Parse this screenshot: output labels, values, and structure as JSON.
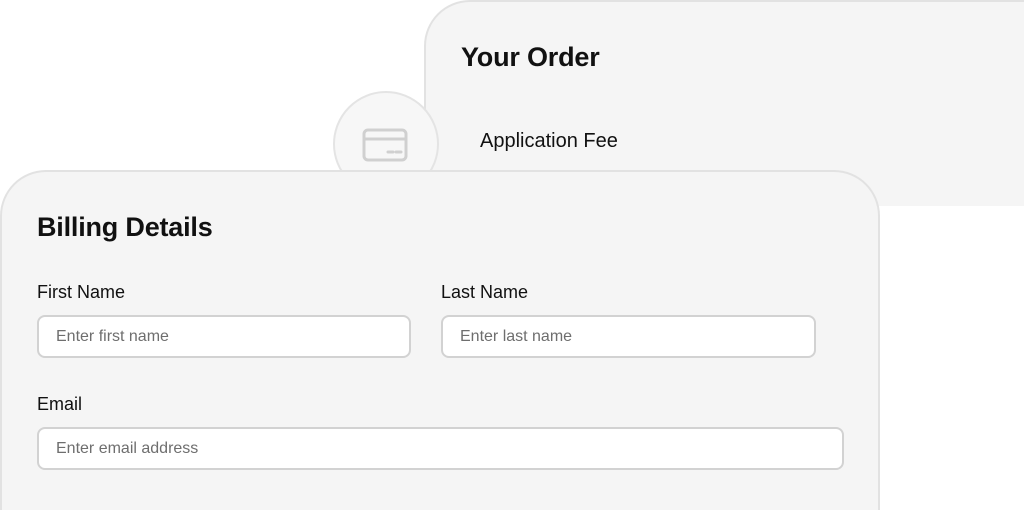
{
  "order": {
    "title": "Your Order",
    "items": [
      {
        "label": "Application Fee"
      }
    ]
  },
  "billing": {
    "title": "Billing Details",
    "first_name": {
      "label": "First Name",
      "placeholder": "Enter first name",
      "value": ""
    },
    "last_name": {
      "label": "Last Name",
      "placeholder": "Enter last name",
      "value": ""
    },
    "email": {
      "label": "Email",
      "placeholder": "Enter email address",
      "value": ""
    }
  },
  "icons": {
    "payment_badge": "credit-card-icon"
  },
  "colors": {
    "card_background": "#f5f5f5",
    "card_border": "#e2e2e2",
    "input_border": "#d2d2d2",
    "icon_stroke": "#d0d0d0"
  }
}
